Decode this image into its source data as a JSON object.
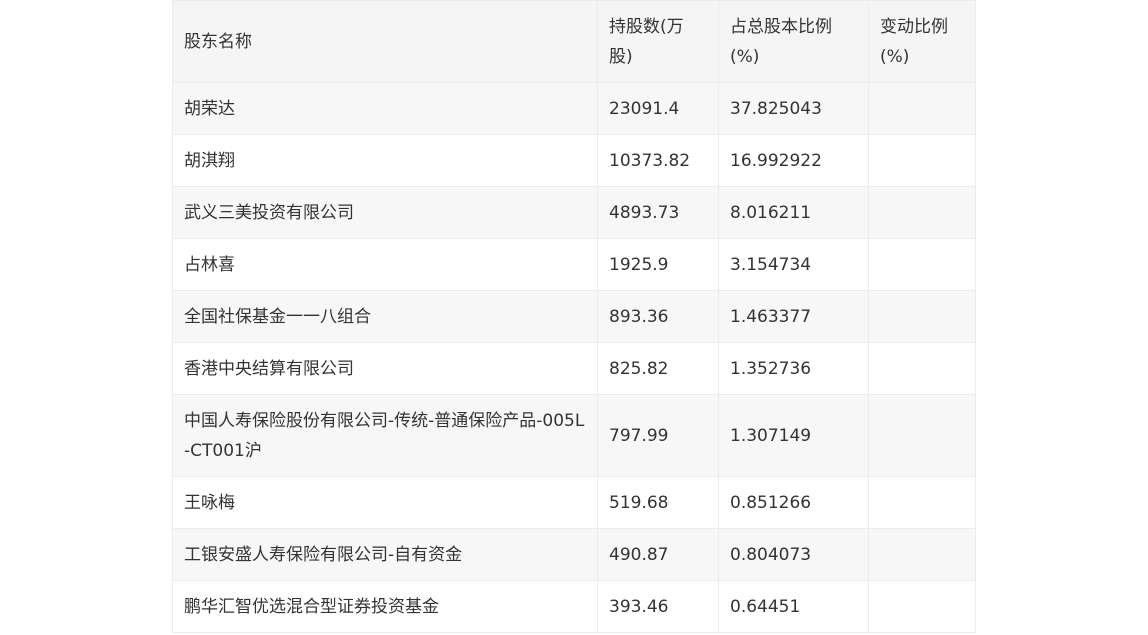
{
  "table": {
    "headers": [
      "股东名称",
      "持股数(万股)",
      "占总股本比例(%)",
      "变动比例(%)"
    ],
    "rows": [
      [
        "胡荣达",
        "23091.4",
        "37.825043",
        ""
      ],
      [
        "胡淇翔",
        "10373.82",
        "16.992922",
        ""
      ],
      [
        "武义三美投资有限公司",
        "4893.73",
        "8.016211",
        ""
      ],
      [
        "占林喜",
        "1925.9",
        "3.154734",
        ""
      ],
      [
        "全国社保基金一一八组合",
        "893.36",
        "1.463377",
        ""
      ],
      [
        "香港中央结算有限公司",
        "825.82",
        "1.352736",
        ""
      ],
      [
        "中国人寿保险股份有限公司-传统-普通保险产品-005L-CT001沪",
        "797.99",
        "1.307149",
        ""
      ],
      [
        "王咏梅",
        "519.68",
        "0.851266",
        ""
      ],
      [
        "工银安盛人寿保险有限公司-自有资金",
        "490.87",
        "0.804073",
        ""
      ],
      [
        "鹏华汇智优选混合型证券投资基金",
        "393.46",
        "0.64451",
        ""
      ]
    ]
  }
}
